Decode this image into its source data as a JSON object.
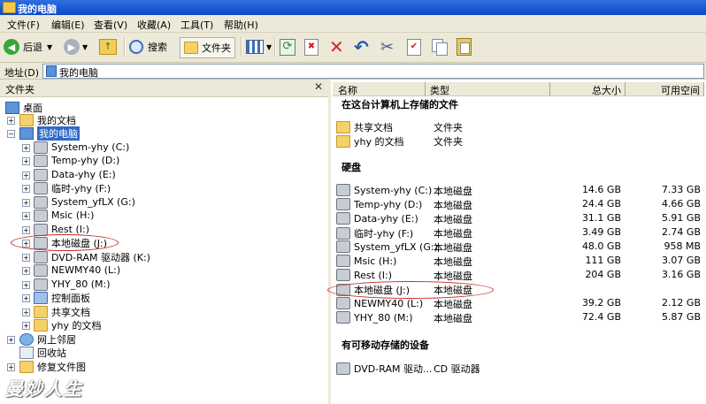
{
  "window": {
    "title": "我的电脑"
  },
  "menu": [
    "文件(F)",
    "编辑(E)",
    "查看(V)",
    "收藏(A)",
    "工具(T)",
    "帮助(H)"
  ],
  "toolbar": {
    "back_label": "后退",
    "search_label": "搜索",
    "folders_label": "文件夹"
  },
  "address": {
    "label": "地址(D)",
    "value": "我的电脑"
  },
  "left_pane": {
    "title": "文件夹",
    "close_glyph": "✕",
    "tree": [
      {
        "label": "桌面",
        "icon": "desktop-icon"
      },
      {
        "label": "我的文档",
        "icon": "folder-icon"
      },
      {
        "label": "我的电脑",
        "icon": "computer-icon"
      },
      {
        "label": "System-yhy (C:)",
        "icon": "drive-icon"
      },
      {
        "label": "Temp-yhy (D:)",
        "icon": "drive-icon"
      },
      {
        "label": "Data-yhy (E:)",
        "icon": "drive-icon"
      },
      {
        "label": "临时-yhy (F:)",
        "icon": "drive-icon"
      },
      {
        "label": "System_yfLX (G:)",
        "icon": "drive-icon"
      },
      {
        "label": "Msic (H:)",
        "icon": "drive-icon"
      },
      {
        "label": "Rest (I:)",
        "icon": "drive-icon"
      },
      {
        "label": "本地磁盘 (J:)",
        "icon": "drive-icon"
      },
      {
        "label": "DVD-RAM 驱动器 (K:)",
        "icon": "dvd-icon"
      },
      {
        "label": "NEWMY40 (L:)",
        "icon": "drive-icon"
      },
      {
        "label": "YHY_80 (M:)",
        "icon": "drive-icon"
      },
      {
        "label": "控制面板",
        "icon": "control-panel-icon"
      },
      {
        "label": "共享文档",
        "icon": "folder-icon"
      },
      {
        "label": "yhy 的文档",
        "icon": "folder-icon"
      },
      {
        "label": "网上邻居",
        "icon": "network-icon"
      },
      {
        "label": "回收站",
        "icon": "recycle-bin-icon"
      },
      {
        "label": "修复文件图",
        "icon": "folder-icon"
      }
    ]
  },
  "right_pane": {
    "columns": {
      "name": "名称",
      "type": "类型",
      "total": "总大小",
      "free": "可用空间"
    },
    "group_files": "在这台计算机上存储的文件",
    "group_disks": "硬盘",
    "group_removable": "有可移动存储的设备",
    "folders": [
      {
        "name": "共享文档",
        "type": "文件夹"
      },
      {
        "name": "yhy 的文档",
        "type": "文件夹"
      }
    ],
    "disks": [
      {
        "name": "System-yhy (C:)",
        "type": "本地磁盘",
        "total": "14.6 GB",
        "free": "7.33 GB"
      },
      {
        "name": "Temp-yhy (D:)",
        "type": "本地磁盘",
        "total": "24.4 GB",
        "free": "4.66 GB"
      },
      {
        "name": "Data-yhy (E:)",
        "type": "本地磁盘",
        "total": "31.1 GB",
        "free": "5.91 GB"
      },
      {
        "name": "临时-yhy (F:)",
        "type": "本地磁盘",
        "total": "3.49 GB",
        "free": "2.74 GB"
      },
      {
        "name": "System_yfLX (G:)",
        "type": "本地磁盘",
        "total": "48.0 GB",
        "free": "958 MB"
      },
      {
        "name": "Msic (H:)",
        "type": "本地磁盘",
        "total": "111 GB",
        "free": "3.07 GB"
      },
      {
        "name": "Rest (I:)",
        "type": "本地磁盘",
        "total": "204 GB",
        "free": "3.16 GB"
      },
      {
        "name": "本地磁盘 (J:)",
        "type": "本地磁盘",
        "total": "",
        "free": ""
      },
      {
        "name": "NEWMY40 (L:)",
        "type": "本地磁盘",
        "total": "39.2 GB",
        "free": "2.12 GB"
      },
      {
        "name": "YHY_80 (M:)",
        "type": "本地磁盘",
        "total": "72.4 GB",
        "free": "5.87 GB"
      }
    ],
    "removable": [
      {
        "name": "DVD-RAM 驱动...",
        "type": "CD 驱动器"
      }
    ]
  },
  "watermark": "曼妙人生",
  "colors": {
    "title_bar": "#0a48c8",
    "chrome": "#ece9d8",
    "selection": "#316ac5",
    "highlight_oval": "#c62828"
  }
}
